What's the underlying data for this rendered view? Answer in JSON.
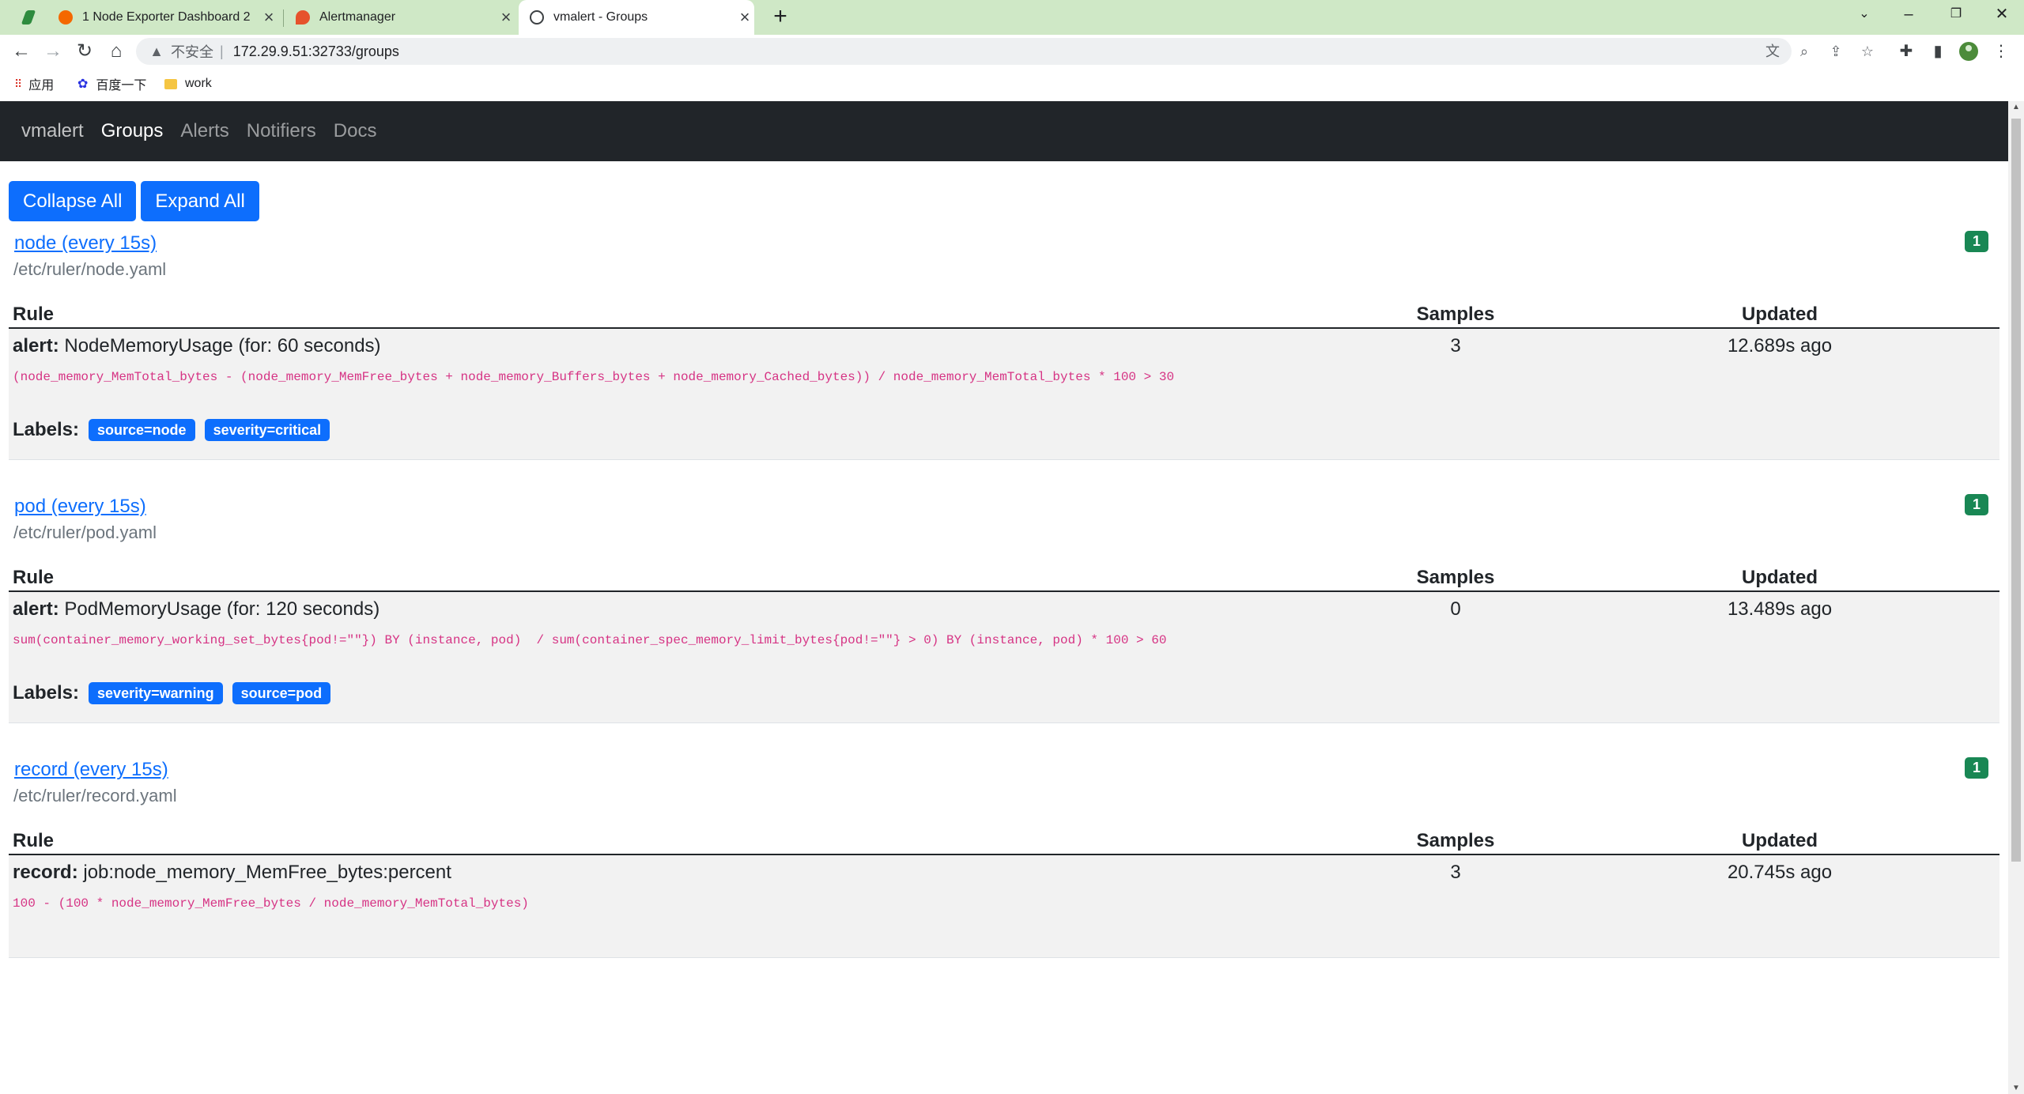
{
  "browser": {
    "tabs": [
      {
        "title": "1 Node Exporter Dashboard 2",
        "close": "×"
      },
      {
        "title": "Alertmanager",
        "close": "×"
      },
      {
        "title": "vmalert - Groups",
        "close": "×"
      }
    ],
    "new_tab": "+",
    "address": {
      "insecure_label": "不安全",
      "url": "172.29.9.51:32733/groups"
    },
    "bookmarks": [
      {
        "label": "应用"
      },
      {
        "label": "百度一下"
      },
      {
        "label": "work"
      }
    ]
  },
  "app": {
    "brand": "vmalert",
    "nav": [
      {
        "label": "Groups",
        "active": true
      },
      {
        "label": "Alerts",
        "active": false
      },
      {
        "label": "Notifiers",
        "active": false
      },
      {
        "label": "Docs",
        "active": false
      }
    ],
    "buttons": {
      "collapse_all": "Collapse All",
      "expand_all": "Expand All"
    },
    "table_headers": {
      "rule": "Rule",
      "samples": "Samples",
      "updated": "Updated"
    },
    "labels_title": "Labels:",
    "groups": [
      {
        "name": "node (every 15s)",
        "file": "/etc/ruler/node.yaml",
        "count": "1",
        "rule": {
          "kind": "alert:",
          "name": "NodeMemoryUsage (for: 60 seconds)",
          "samples": "3",
          "updated": "12.689s ago",
          "expr": "(node_memory_MemTotal_bytes - (node_memory_MemFree_bytes + node_memory_Buffers_bytes + node_memory_Cached_bytes)) / node_memory_MemTotal_bytes * 100 > 30",
          "labels": [
            "source=node",
            "severity=critical"
          ]
        }
      },
      {
        "name": "pod (every 15s)",
        "file": "/etc/ruler/pod.yaml",
        "count": "1",
        "rule": {
          "kind": "alert:",
          "name": "PodMemoryUsage (for: 120 seconds)",
          "samples": "0",
          "updated": "13.489s ago",
          "expr": "sum(container_memory_working_set_bytes{pod!=\"\"}) BY (instance, pod)  / sum(container_spec_memory_limit_bytes{pod!=\"\"} > 0) BY (instance, pod) * 100 > 60",
          "labels": [
            "severity=warning",
            "source=pod"
          ]
        }
      },
      {
        "name": "record (every 15s)",
        "file": "/etc/ruler/record.yaml",
        "count": "1",
        "rule": {
          "kind": "record:",
          "name": "job:node_memory_MemFree_bytes:percent",
          "samples": "3",
          "updated": "20.745s ago",
          "expr": "100 - (100 * node_memory_MemFree_bytes / node_memory_MemTotal_bytes)",
          "labels": []
        }
      }
    ]
  },
  "colors": {
    "primary": "#0d6efd",
    "success": "#198754",
    "navbar": "#212529",
    "code": "#d63384",
    "tabstrip": "#cfe8c6"
  }
}
